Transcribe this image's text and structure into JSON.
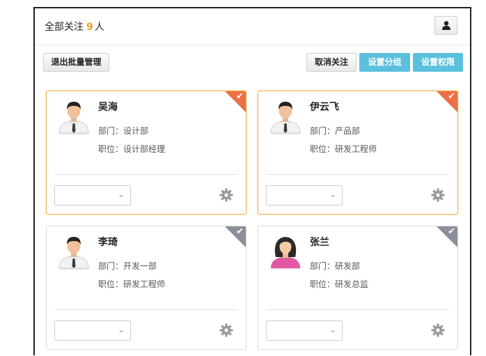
{
  "header": {
    "title_prefix": "全部关注",
    "count": "9",
    "title_suffix": "人",
    "user_icon": "user-icon"
  },
  "toolbar": {
    "exit_batch_label": "退出批量管理",
    "unfollow_label": "取消关注",
    "set_group_label": "设置分组",
    "set_permission_label": "设置权限"
  },
  "colors": {
    "accent_info": "#5bc0de",
    "selected_border": "#f0b44a",
    "selected_corner": "#ec6f45",
    "unselected_corner": "#8a8f9b",
    "count_color": "#f0a020"
  },
  "cards": [
    {
      "name": "吴海",
      "dept": "部门：设计部",
      "position": "职位：设计部经理",
      "selected": true,
      "avatar": "male"
    },
    {
      "name": "伊云飞",
      "dept": "部门：产品部",
      "position": "职位：研发工程师",
      "selected": true,
      "avatar": "male"
    },
    {
      "name": "李琦",
      "dept": "部门：开发一部",
      "position": "职位：研发工程师",
      "selected": false,
      "avatar": "male"
    },
    {
      "name": "张兰",
      "dept": "部门：研发部",
      "position": "职位：研发总监",
      "selected": false,
      "avatar": "female"
    }
  ],
  "check_glyph": "✔",
  "select_chevron": "⌄"
}
